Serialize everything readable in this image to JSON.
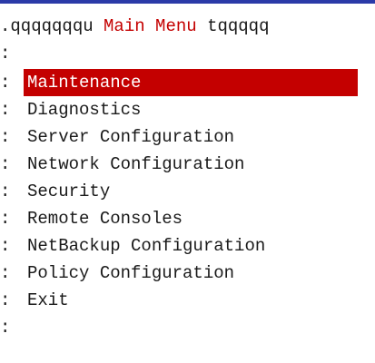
{
  "header": {
    "left_border": ".qqqqqqqu",
    "title": "Main Menu",
    "right_border": "tqqqqq"
  },
  "left_border_char": ":",
  "menu": {
    "selected_index": 0,
    "items": [
      {
        "label": "Maintenance"
      },
      {
        "label": "Diagnostics"
      },
      {
        "label": "Server Configuration"
      },
      {
        "label": "Network Configuration"
      },
      {
        "label": "Security"
      },
      {
        "label": "Remote Consoles"
      },
      {
        "label": "NetBackup Configuration"
      },
      {
        "label": "Policy Configuration"
      },
      {
        "label": "Exit"
      }
    ]
  },
  "colors": {
    "selection_bg": "#c40000",
    "title_fg": "#c40000",
    "top_rule": "#2b3aa8"
  }
}
